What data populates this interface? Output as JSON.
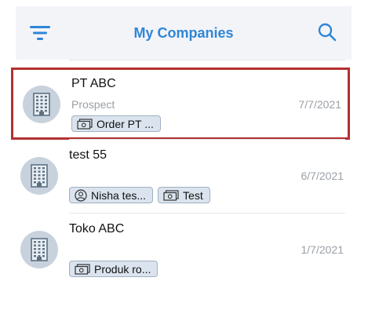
{
  "header": {
    "title": "My Companies",
    "filter_icon": "filter-icon",
    "search_icon": "search-icon",
    "accent_color": "#2f86d6"
  },
  "companies": [
    {
      "name": "PT ABC",
      "status": "Prospect",
      "date": "7/7/2021",
      "selected": true,
      "tags": [
        {
          "icon": "money-icon",
          "label": "Order PT ..."
        }
      ]
    },
    {
      "name": "test 55",
      "status": "",
      "date": "6/7/2021",
      "selected": false,
      "tags": [
        {
          "icon": "person-icon",
          "label": "Nisha tes..."
        },
        {
          "icon": "money-icon",
          "label": "Test"
        }
      ]
    },
    {
      "name": "Toko ABC",
      "status": "",
      "date": "1/7/2021",
      "selected": false,
      "tags": [
        {
          "icon": "money-icon",
          "label": "Produk ro..."
        }
      ]
    }
  ],
  "selection_color": "#b23030",
  "avatar_icon": "building-icon"
}
